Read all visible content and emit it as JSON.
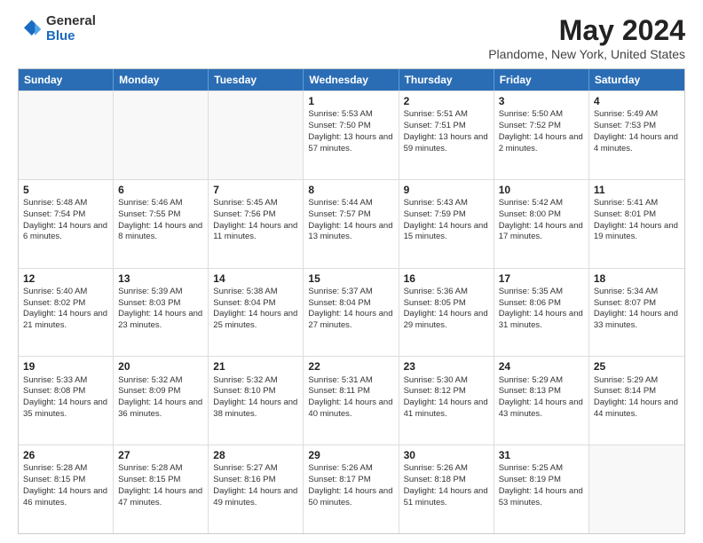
{
  "logo": {
    "general": "General",
    "blue": "Blue"
  },
  "title": "May 2024",
  "subtitle": "Plandome, New York, United States",
  "header_days": [
    "Sunday",
    "Monday",
    "Tuesday",
    "Wednesday",
    "Thursday",
    "Friday",
    "Saturday"
  ],
  "rows": [
    [
      {
        "day": "",
        "text": "",
        "empty": true
      },
      {
        "day": "",
        "text": "",
        "empty": true
      },
      {
        "day": "",
        "text": "",
        "empty": true
      },
      {
        "day": "1",
        "text": "Sunrise: 5:53 AM\nSunset: 7:50 PM\nDaylight: 13 hours and 57 minutes."
      },
      {
        "day": "2",
        "text": "Sunrise: 5:51 AM\nSunset: 7:51 PM\nDaylight: 13 hours and 59 minutes."
      },
      {
        "day": "3",
        "text": "Sunrise: 5:50 AM\nSunset: 7:52 PM\nDaylight: 14 hours and 2 minutes."
      },
      {
        "day": "4",
        "text": "Sunrise: 5:49 AM\nSunset: 7:53 PM\nDaylight: 14 hours and 4 minutes."
      }
    ],
    [
      {
        "day": "5",
        "text": "Sunrise: 5:48 AM\nSunset: 7:54 PM\nDaylight: 14 hours and 6 minutes."
      },
      {
        "day": "6",
        "text": "Sunrise: 5:46 AM\nSunset: 7:55 PM\nDaylight: 14 hours and 8 minutes."
      },
      {
        "day": "7",
        "text": "Sunrise: 5:45 AM\nSunset: 7:56 PM\nDaylight: 14 hours and 11 minutes."
      },
      {
        "day": "8",
        "text": "Sunrise: 5:44 AM\nSunset: 7:57 PM\nDaylight: 14 hours and 13 minutes."
      },
      {
        "day": "9",
        "text": "Sunrise: 5:43 AM\nSunset: 7:59 PM\nDaylight: 14 hours and 15 minutes."
      },
      {
        "day": "10",
        "text": "Sunrise: 5:42 AM\nSunset: 8:00 PM\nDaylight: 14 hours and 17 minutes."
      },
      {
        "day": "11",
        "text": "Sunrise: 5:41 AM\nSunset: 8:01 PM\nDaylight: 14 hours and 19 minutes."
      }
    ],
    [
      {
        "day": "12",
        "text": "Sunrise: 5:40 AM\nSunset: 8:02 PM\nDaylight: 14 hours and 21 minutes."
      },
      {
        "day": "13",
        "text": "Sunrise: 5:39 AM\nSunset: 8:03 PM\nDaylight: 14 hours and 23 minutes."
      },
      {
        "day": "14",
        "text": "Sunrise: 5:38 AM\nSunset: 8:04 PM\nDaylight: 14 hours and 25 minutes."
      },
      {
        "day": "15",
        "text": "Sunrise: 5:37 AM\nSunset: 8:04 PM\nDaylight: 14 hours and 27 minutes."
      },
      {
        "day": "16",
        "text": "Sunrise: 5:36 AM\nSunset: 8:05 PM\nDaylight: 14 hours and 29 minutes."
      },
      {
        "day": "17",
        "text": "Sunrise: 5:35 AM\nSunset: 8:06 PM\nDaylight: 14 hours and 31 minutes."
      },
      {
        "day": "18",
        "text": "Sunrise: 5:34 AM\nSunset: 8:07 PM\nDaylight: 14 hours and 33 minutes."
      }
    ],
    [
      {
        "day": "19",
        "text": "Sunrise: 5:33 AM\nSunset: 8:08 PM\nDaylight: 14 hours and 35 minutes."
      },
      {
        "day": "20",
        "text": "Sunrise: 5:32 AM\nSunset: 8:09 PM\nDaylight: 14 hours and 36 minutes."
      },
      {
        "day": "21",
        "text": "Sunrise: 5:32 AM\nSunset: 8:10 PM\nDaylight: 14 hours and 38 minutes."
      },
      {
        "day": "22",
        "text": "Sunrise: 5:31 AM\nSunset: 8:11 PM\nDaylight: 14 hours and 40 minutes."
      },
      {
        "day": "23",
        "text": "Sunrise: 5:30 AM\nSunset: 8:12 PM\nDaylight: 14 hours and 41 minutes."
      },
      {
        "day": "24",
        "text": "Sunrise: 5:29 AM\nSunset: 8:13 PM\nDaylight: 14 hours and 43 minutes."
      },
      {
        "day": "25",
        "text": "Sunrise: 5:29 AM\nSunset: 8:14 PM\nDaylight: 14 hours and 44 minutes."
      }
    ],
    [
      {
        "day": "26",
        "text": "Sunrise: 5:28 AM\nSunset: 8:15 PM\nDaylight: 14 hours and 46 minutes."
      },
      {
        "day": "27",
        "text": "Sunrise: 5:28 AM\nSunset: 8:15 PM\nDaylight: 14 hours and 47 minutes."
      },
      {
        "day": "28",
        "text": "Sunrise: 5:27 AM\nSunset: 8:16 PM\nDaylight: 14 hours and 49 minutes."
      },
      {
        "day": "29",
        "text": "Sunrise: 5:26 AM\nSunset: 8:17 PM\nDaylight: 14 hours and 50 minutes."
      },
      {
        "day": "30",
        "text": "Sunrise: 5:26 AM\nSunset: 8:18 PM\nDaylight: 14 hours and 51 minutes."
      },
      {
        "day": "31",
        "text": "Sunrise: 5:25 AM\nSunset: 8:19 PM\nDaylight: 14 hours and 53 minutes."
      },
      {
        "day": "",
        "text": "",
        "empty": true
      }
    ]
  ]
}
